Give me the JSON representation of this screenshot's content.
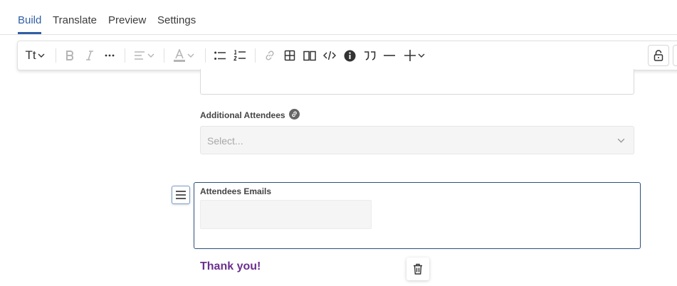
{
  "tabs": [
    {
      "label": "Build",
      "active": true
    },
    {
      "label": "Translate",
      "active": false
    },
    {
      "label": "Preview",
      "active": false
    },
    {
      "label": "Settings",
      "active": false
    }
  ],
  "toolbar": {
    "text_style_label": "Tt",
    "icons": [
      "text-style",
      "bold",
      "italic",
      "more-formatting",
      "align",
      "text-color",
      "bullet-list",
      "numbered-list",
      "link",
      "table",
      "columns",
      "code",
      "info",
      "blockquote",
      "horizontal-rule",
      "insert"
    ]
  },
  "form": {
    "additional_attendees": {
      "label": "Additional Attendees",
      "placeholder": "Select..."
    },
    "attendees_emails": {
      "label": "Attendees Emails",
      "value": ""
    },
    "thank_you": "Thank you!"
  },
  "colors": {
    "accent": "#2f5fa5",
    "active_border": "#2b4f7a",
    "thank_you": "#6b2f8f"
  }
}
